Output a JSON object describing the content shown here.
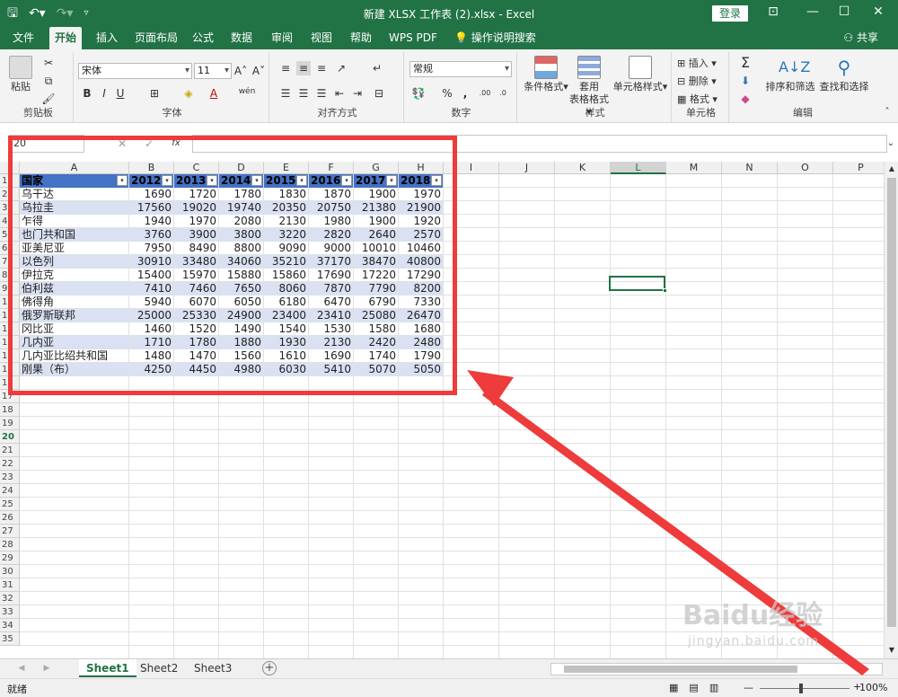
{
  "window": {
    "title": "新建 XLSX 工作表 (2).xlsx  -  Excel",
    "login": "登录",
    "share": "共享"
  },
  "tabs": [
    "文件",
    "开始",
    "插入",
    "页面布局",
    "公式",
    "数据",
    "审阅",
    "视图",
    "帮助",
    "WPS PDF",
    "操作说明搜索"
  ],
  "ribbon": {
    "clipboard": {
      "label": "剪贴板",
      "paste": "粘贴"
    },
    "font": {
      "label": "字体",
      "name": "宋体",
      "size": "11",
      "wen": "wén"
    },
    "align": {
      "label": "对齐方式"
    },
    "number": {
      "label": "数字",
      "format": "常规"
    },
    "styles": {
      "label": "样式",
      "cond": "条件格式",
      "table_a": "套用",
      "table_b": "表格格式",
      "cell": "单元格样式"
    },
    "cells": {
      "label": "单元格",
      "insert": "插入",
      "delete": "删除",
      "format": "格式"
    },
    "edit": {
      "label": "编辑",
      "sort": "排序和筛选",
      "find": "查找和选择"
    }
  },
  "formula": {
    "namebox": "20",
    "fx": "fx"
  },
  "columns": [
    "A",
    "B",
    "C",
    "D",
    "E",
    "F",
    "G",
    "H",
    "I",
    "J",
    "K",
    "L",
    "M",
    "N",
    "O",
    "P"
  ],
  "table": {
    "headers": [
      "国家",
      "2012",
      "2013",
      "2014",
      "2015",
      "2016",
      "2017",
      "2018"
    ],
    "rows": [
      [
        "乌干达",
        "1690",
        "1720",
        "1780",
        "1830",
        "1870",
        "1900",
        "1970"
      ],
      [
        "乌拉圭",
        "17560",
        "19020",
        "19740",
        "20350",
        "20750",
        "21380",
        "21900"
      ],
      [
        "乍得",
        "1940",
        "1970",
        "2080",
        "2130",
        "1980",
        "1900",
        "1920"
      ],
      [
        "也门共和国",
        "3760",
        "3900",
        "3800",
        "3220",
        "2820",
        "2640",
        "2570"
      ],
      [
        "亚美尼亚",
        "7950",
        "8490",
        "8800",
        "9090",
        "9000",
        "10010",
        "10460"
      ],
      [
        "以色列",
        "30910",
        "33480",
        "34060",
        "35210",
        "37170",
        "38470",
        "40800"
      ],
      [
        "伊拉克",
        "15400",
        "15970",
        "15880",
        "15860",
        "17690",
        "17220",
        "17290"
      ],
      [
        "伯利兹",
        "7410",
        "7460",
        "7650",
        "8060",
        "7870",
        "7790",
        "8200"
      ],
      [
        "佛得角",
        "5940",
        "6070",
        "6050",
        "6180",
        "6470",
        "6790",
        "7330"
      ],
      [
        "俄罗斯联邦",
        "25000",
        "25330",
        "24900",
        "23400",
        "23410",
        "25080",
        "26470"
      ],
      [
        "冈比亚",
        "1460",
        "1520",
        "1490",
        "1540",
        "1530",
        "1580",
        "1680"
      ],
      [
        "几内亚",
        "1710",
        "1780",
        "1880",
        "1930",
        "2130",
        "2420",
        "2480"
      ],
      [
        "几内亚比绍共和国",
        "1480",
        "1470",
        "1560",
        "1610",
        "1690",
        "1740",
        "1790"
      ],
      [
        "刚果（布）",
        "4250",
        "4450",
        "4980",
        "6030",
        "5410",
        "5070",
        "5050"
      ]
    ]
  },
  "row_numbers": [
    "1",
    "2",
    "3",
    "4",
    "5",
    "6",
    "7",
    "8",
    "9",
    "10",
    "11",
    "12",
    "13",
    "14",
    "15",
    "16",
    "17",
    "18",
    "19",
    "20",
    "21",
    "22",
    "23",
    "24",
    "25",
    "26",
    "27",
    "28",
    "29",
    "30",
    "31",
    "32",
    "33",
    "34",
    "35"
  ],
  "sheets": [
    "Sheet1",
    "Sheet2",
    "Sheet3"
  ],
  "status": {
    "ready": "就绪",
    "zoom": "100%"
  },
  "watermark": {
    "brand": "Baidu经验",
    "url": "jingyan.baidu.com"
  },
  "colors": {
    "excel_green": "#217346",
    "table_header": "#4472c4",
    "table_band": "#d9e1f2",
    "annotation_red": "#ee3b3b"
  }
}
